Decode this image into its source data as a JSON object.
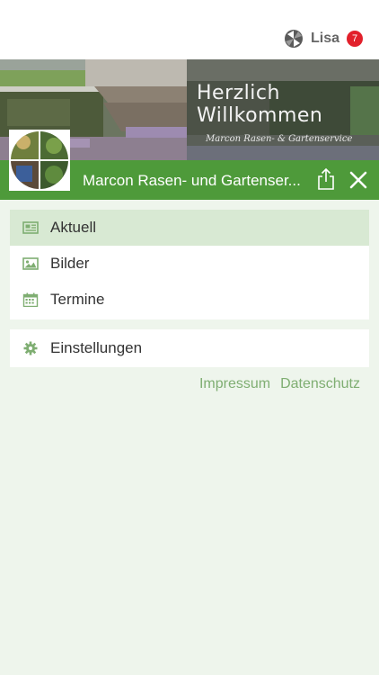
{
  "top_bar": {
    "user_name": "Lisa",
    "notification_count": "7",
    "badge_color": "#e2202b"
  },
  "hero": {
    "welcome_line1": "Herzlich",
    "welcome_line2": "Willkommen",
    "welcome_subtitle": "Marcon Rasen- & Gartenservice"
  },
  "header": {
    "company_name": "Marcon Rasen- und Gartenser...",
    "accent_color": "#4e9a3a",
    "share_icon": "share-icon",
    "close_icon": "close-icon"
  },
  "menu": {
    "items": [
      {
        "label": "Aktuell",
        "icon": "newspaper-icon",
        "active": true
      },
      {
        "label": "Bilder",
        "icon": "image-icon",
        "active": false
      },
      {
        "label": "Termine",
        "icon": "calendar-icon",
        "active": false
      }
    ],
    "settings": {
      "label": "Einstellungen",
      "icon": "gear-icon"
    }
  },
  "footer": {
    "impressum": "Impressum",
    "datenschutz": "Datenschutz"
  }
}
